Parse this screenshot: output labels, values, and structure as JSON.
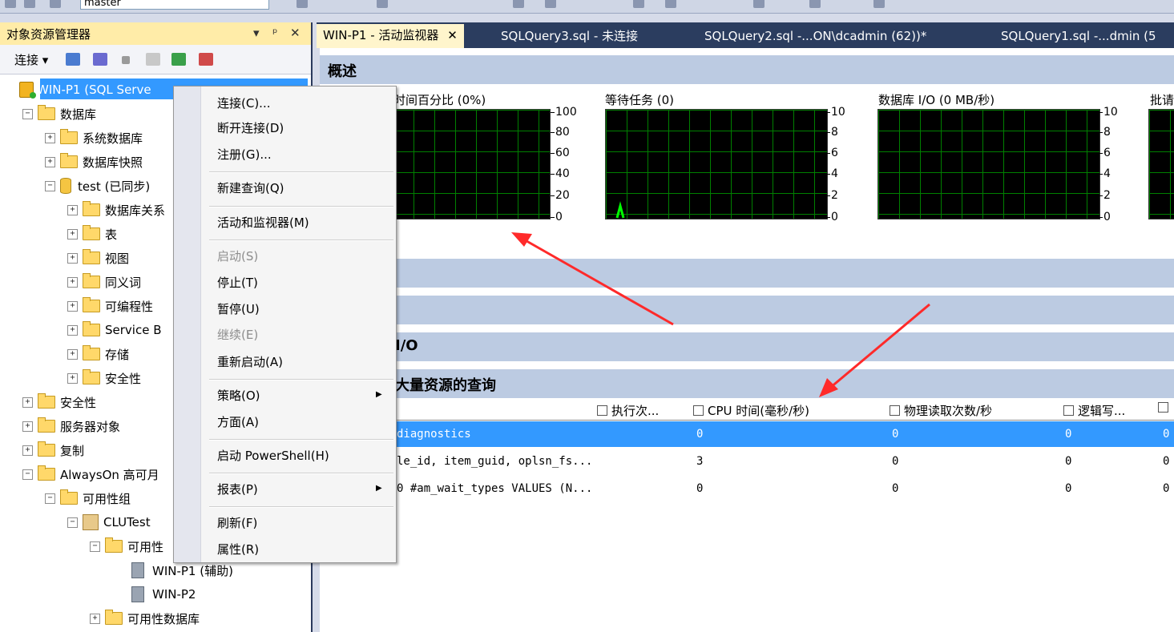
{
  "toolbar": {
    "database_selector": "master"
  },
  "object_explorer": {
    "title": "对象资源管理器",
    "pin_controls": [
      "▾",
      "ᵖ",
      "✕"
    ],
    "connect_label": "连接",
    "tree": [
      {
        "label": "WIN-P1 (SQL Serve",
        "level": 0,
        "icon": "server-root",
        "expander": ""
      },
      {
        "label": "数据库",
        "level": 1,
        "icon": "folder",
        "expander": "−"
      },
      {
        "label": "系统数据库",
        "level": 2,
        "icon": "folder",
        "expander": "+"
      },
      {
        "label": "数据库快照",
        "level": 2,
        "icon": "folder",
        "expander": "+"
      },
      {
        "label": "test (已同步)",
        "level": 2,
        "icon": "database",
        "expander": "−"
      },
      {
        "label": "数据库关系",
        "level": 3,
        "icon": "folder",
        "expander": "+"
      },
      {
        "label": "表",
        "level": 3,
        "icon": "folder",
        "expander": "+"
      },
      {
        "label": "视图",
        "level": 3,
        "icon": "folder",
        "expander": "+"
      },
      {
        "label": "同义词",
        "level": 3,
        "icon": "folder",
        "expander": "+"
      },
      {
        "label": "可编程性",
        "level": 3,
        "icon": "folder",
        "expander": "+"
      },
      {
        "label": "Service B",
        "level": 3,
        "icon": "folder",
        "expander": "+"
      },
      {
        "label": "存储",
        "level": 3,
        "icon": "folder",
        "expander": "+"
      },
      {
        "label": "安全性",
        "level": 3,
        "icon": "folder",
        "expander": "+"
      },
      {
        "label": "安全性",
        "level": 1,
        "icon": "folder",
        "expander": "+"
      },
      {
        "label": "服务器对象",
        "level": 1,
        "icon": "folder",
        "expander": "+"
      },
      {
        "label": "复制",
        "level": 1,
        "icon": "folder",
        "expander": "+"
      },
      {
        "label": "AlwaysOn 高可月",
        "level": 1,
        "icon": "folder",
        "expander": "−"
      },
      {
        "label": "可用性组",
        "level": 2,
        "icon": "folder",
        "expander": "−"
      },
      {
        "label": "CLUTest",
        "level": 3,
        "icon": "availability-group",
        "expander": "−"
      },
      {
        "label": "可用性",
        "level": 4,
        "icon": "folder",
        "expander": "−"
      },
      {
        "label": "WIN-P1 (辅助)",
        "level": 5,
        "icon": "server",
        "expander": ""
      },
      {
        "label": "WIN-P2",
        "level": 5,
        "icon": "server",
        "expander": ""
      },
      {
        "label": "可用性数据库",
        "level": 4,
        "icon": "folder",
        "expander": "+"
      }
    ]
  },
  "context_menu": {
    "items": [
      {
        "label": "连接(C)...",
        "disabled": false,
        "submenu": false
      },
      {
        "label": "断开连接(D)",
        "disabled": false,
        "submenu": false
      },
      {
        "label": "注册(G)...",
        "disabled": false,
        "submenu": false
      },
      {
        "label": "新建查询(Q)",
        "disabled": false,
        "submenu": false
      },
      {
        "label": "活动和监视器(M)",
        "disabled": false,
        "submenu": false
      },
      {
        "label": "启动(S)",
        "disabled": true,
        "submenu": false
      },
      {
        "label": "停止(T)",
        "disabled": false,
        "submenu": false
      },
      {
        "label": "暂停(U)",
        "disabled": false,
        "submenu": false
      },
      {
        "label": "继续(E)",
        "disabled": true,
        "submenu": false
      },
      {
        "label": "重新启动(A)",
        "disabled": false,
        "submenu": false
      },
      {
        "label": "策略(O)",
        "disabled": false,
        "submenu": true
      },
      {
        "label": "方面(A)",
        "disabled": false,
        "submenu": false
      },
      {
        "label": "启动 PowerShell(H)",
        "disabled": false,
        "submenu": false
      },
      {
        "label": "报表(P)",
        "disabled": false,
        "submenu": true
      },
      {
        "label": "刷新(F)",
        "disabled": false,
        "submenu": false
      },
      {
        "label": "属性(R)",
        "disabled": false,
        "submenu": false
      }
    ]
  },
  "tabs": [
    {
      "label": "WIN-P1 - 活动监视器",
      "close": "✕",
      "active": true
    },
    {
      "label": "SQLQuery3.sql - 未连接",
      "active": false
    },
    {
      "label": "SQLQuery2.sql -...ON\\dcadmin (62))*",
      "active": false
    },
    {
      "label": "SQLQuery1.sql -...dmin (5",
      "active": false
    }
  ],
  "activity_monitor": {
    "overview_title": "概述",
    "charts": [
      {
        "label": "时间百分比 (0%)",
        "ticks": [
          "100",
          "80",
          "60",
          "40",
          "20",
          "0"
        ]
      },
      {
        "label": "等待任务 (0)",
        "ticks": [
          "10",
          "8",
          "6",
          "4",
          "2",
          "0"
        ]
      },
      {
        "label": "数据库 I/O (0 MB/秒)",
        "ticks": [
          "10",
          "8",
          "6",
          "4",
          "2",
          "0"
        ]
      },
      {
        "label": "批请",
        "ticks": []
      }
    ],
    "sections": [
      "",
      "",
      "I/O",
      "大量资源的查询"
    ],
    "grid": {
      "columns": [
        "执行次...",
        "CPU 时间(毫秒/秒)",
        "物理读取次数/秒",
        "逻辑写..."
      ],
      "rows": [
        {
          "query": "diagnostics",
          "exec": "",
          "cpu": "0",
          "phys": "0",
          "logical": "0",
          "extra": "0",
          "selected": true
        },
        {
          "query": "le_id, item_guid, oplsn_fs...",
          "exec": "",
          "cpu": "3",
          "phys": "0",
          "logical": "0",
          "extra": "0",
          "selected": false
        },
        {
          "query": "0 #am_wait_types VALUES (N...",
          "exec": "",
          "cpu": "0",
          "phys": "0",
          "logical": "0",
          "extra": "0",
          "selected": false
        }
      ]
    }
  },
  "colors": {
    "selection": "#3399ff",
    "annotation_arrow": "#ff2a2a",
    "tab_bar": "#2b3d5f",
    "active_tab": "#fff5cc",
    "section_band": "#bccbe2",
    "chart_grid": "#008000"
  }
}
